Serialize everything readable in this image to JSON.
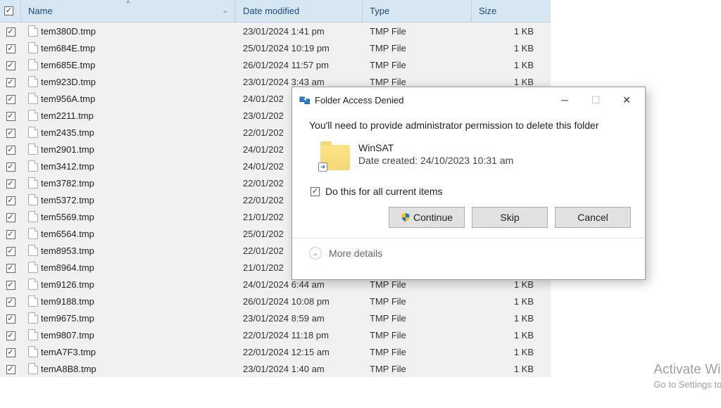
{
  "columns": {
    "name": "Name",
    "date": "Date modified",
    "type": "Type",
    "size": "Size"
  },
  "files": [
    {
      "name": "tem380D.tmp",
      "date": "23/01/2024 1:41 pm",
      "type": "TMP File",
      "size": "1 KB"
    },
    {
      "name": "tem684E.tmp",
      "date": "25/01/2024 10:19 pm",
      "type": "TMP File",
      "size": "1 KB"
    },
    {
      "name": "tem685E.tmp",
      "date": "26/01/2024 11:57 pm",
      "type": "TMP File",
      "size": "1 KB"
    },
    {
      "name": "tem923D.tmp",
      "date": "23/01/2024 3:43 am",
      "type": "TMP File",
      "size": "1 KB"
    },
    {
      "name": "tem956A.tmp",
      "date": "24/01/202",
      "type": "",
      "size": ""
    },
    {
      "name": "tem2211.tmp",
      "date": "23/01/202",
      "type": "",
      "size": ""
    },
    {
      "name": "tem2435.tmp",
      "date": "22/01/202",
      "type": "",
      "size": ""
    },
    {
      "name": "tem2901.tmp",
      "date": "24/01/202",
      "type": "",
      "size": ""
    },
    {
      "name": "tem3412.tmp",
      "date": "24/01/202",
      "type": "",
      "size": ""
    },
    {
      "name": "tem3782.tmp",
      "date": "22/01/202",
      "type": "",
      "size": ""
    },
    {
      "name": "tem5372.tmp",
      "date": "22/01/202",
      "type": "",
      "size": ""
    },
    {
      "name": "tem5569.tmp",
      "date": "21/01/202",
      "type": "",
      "size": ""
    },
    {
      "name": "tem6564.tmp",
      "date": "25/01/202",
      "type": "",
      "size": ""
    },
    {
      "name": "tem8953.tmp",
      "date": "22/01/202",
      "type": "",
      "size": ""
    },
    {
      "name": "tem8964.tmp",
      "date": "21/01/202",
      "type": "",
      "size": ""
    },
    {
      "name": "tem9126.tmp",
      "date": "24/01/2024 6:44 am",
      "type": "TMP File",
      "size": "1 KB"
    },
    {
      "name": "tem9188.tmp",
      "date": "26/01/2024 10:08 pm",
      "type": "TMP File",
      "size": "1 KB"
    },
    {
      "name": "tem9675.tmp",
      "date": "23/01/2024 8:59 am",
      "type": "TMP File",
      "size": "1 KB"
    },
    {
      "name": "tem9807.tmp",
      "date": "22/01/2024 11:18 pm",
      "type": "TMP File",
      "size": "1 KB"
    },
    {
      "name": "temA7F3.tmp",
      "date": "22/01/2024 12:15 am",
      "type": "TMP File",
      "size": "1 KB"
    },
    {
      "name": "temA8B8.tmp",
      "date": "23/01/2024 1:40 am",
      "type": "TMP File",
      "size": "1 KB"
    }
  ],
  "dialog": {
    "title": "Folder Access Denied",
    "message": "You'll need to provide administrator permission to delete this folder",
    "folder_name": "WinSAT",
    "folder_date": "Date created: 24/10/2023 10:31 am",
    "do_all": "Do this for all current items",
    "continue": "Continue",
    "skip": "Skip",
    "cancel": "Cancel",
    "more_details": "More details"
  },
  "watermark": {
    "title": "Activate Win",
    "sub": "Go to Settings to"
  }
}
